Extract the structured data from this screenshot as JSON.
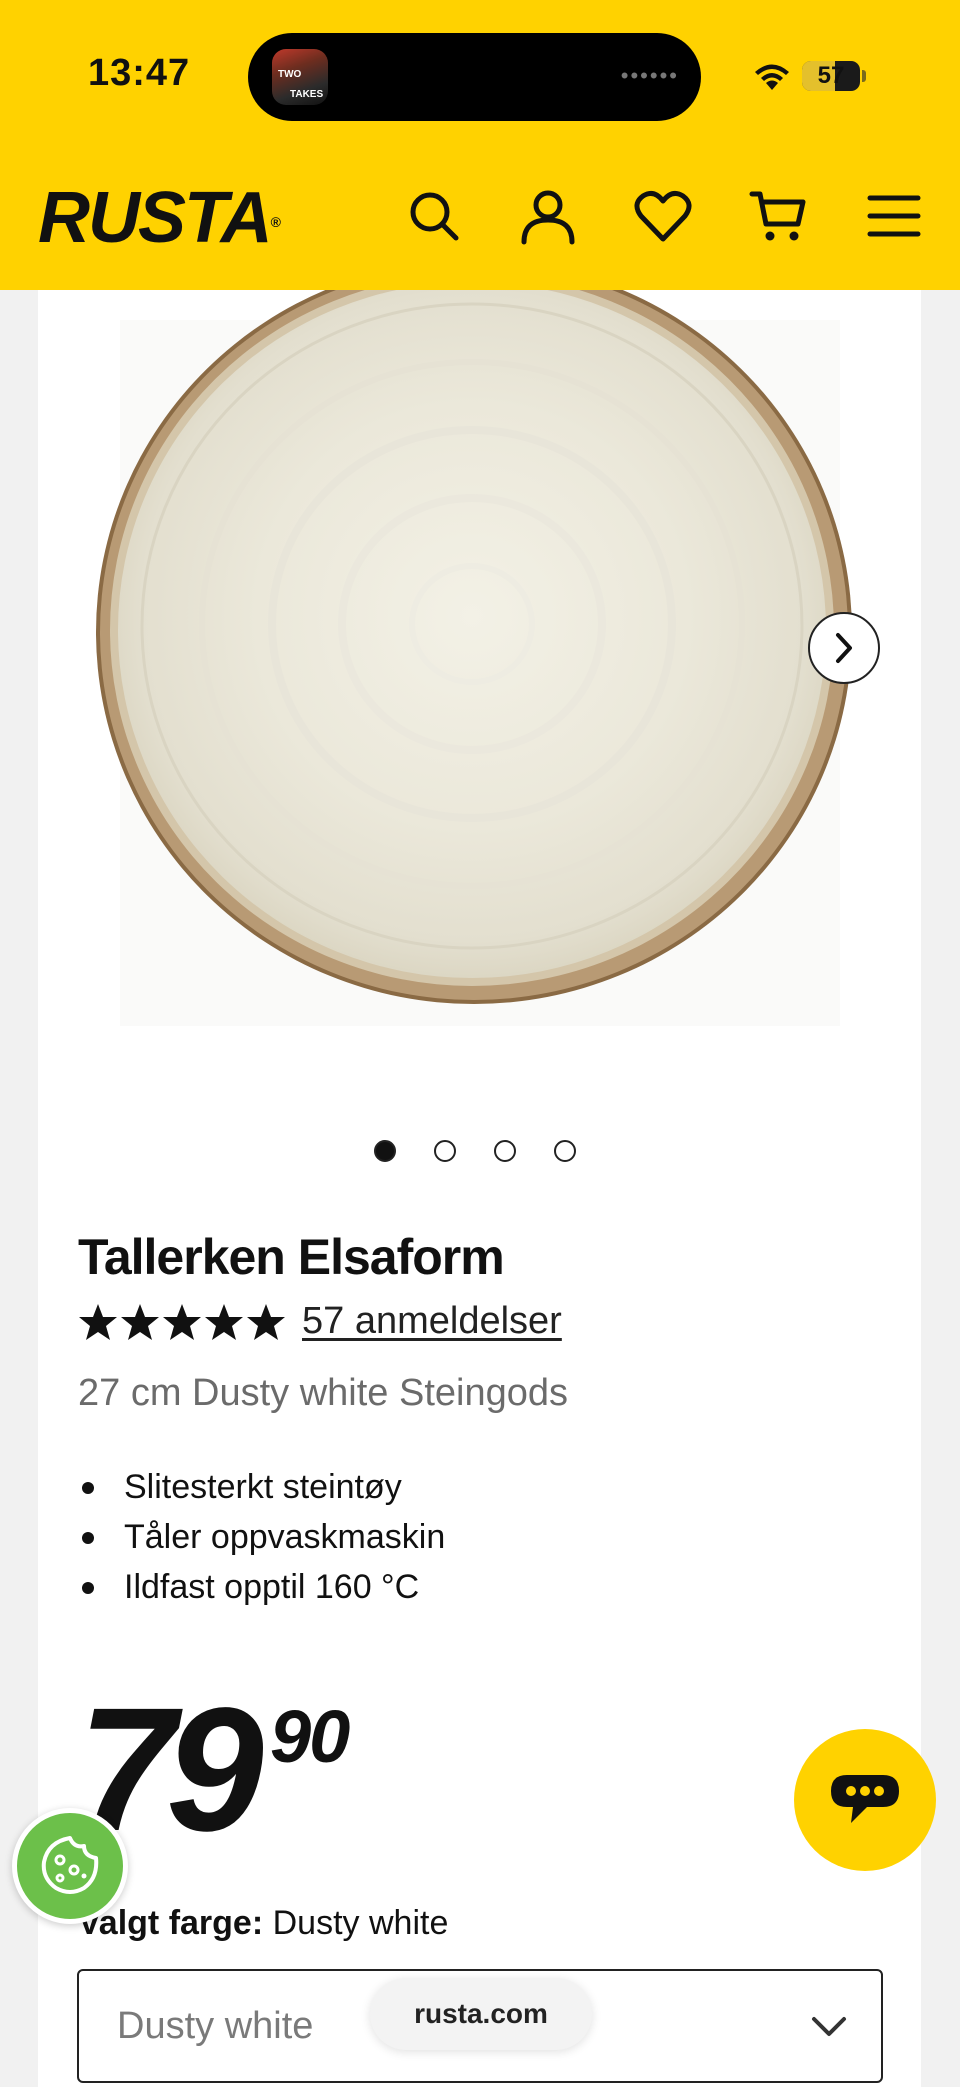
{
  "status_bar": {
    "time": "13:47",
    "battery_level": "57",
    "live_activity_line1": "TWO",
    "live_activity_line2": "TAKES",
    "icons": [
      "wifi-icon",
      "battery-icon"
    ]
  },
  "header": {
    "logo": "RUSTA",
    "logo_mark": "®",
    "background_color": "#ffd200",
    "icons": [
      "search-icon",
      "account-icon",
      "heart-icon",
      "cart-icon",
      "menu-icon"
    ]
  },
  "gallery": {
    "image_alt": "Tallerken Elsaform plate",
    "slide_count": 4,
    "active_slide": 1,
    "next_icon": "chevron-right-icon"
  },
  "product": {
    "title": "Tallerken Elsaform",
    "rating_stars": 5,
    "reviews_link": "57 anmeldelser",
    "subtitle": "27 cm Dusty white Steingods",
    "features": [
      "Slitesterkt steintøy",
      "Tåler oppvaskmaskin",
      "Ildfast opptil 160 °C"
    ],
    "price_integer": "79",
    "price_decimals": "90",
    "color_label": "Valgt farge:",
    "color_value": "Dusty white",
    "color_select_value": "Dusty white"
  },
  "browser": {
    "url": "rusta.com"
  },
  "floating": {
    "chat_icon": "chat-bubble-icon",
    "cookie_icon": "cookie-icon",
    "chat_color": "#ffd200",
    "cookie_color": "#6cc04a"
  }
}
